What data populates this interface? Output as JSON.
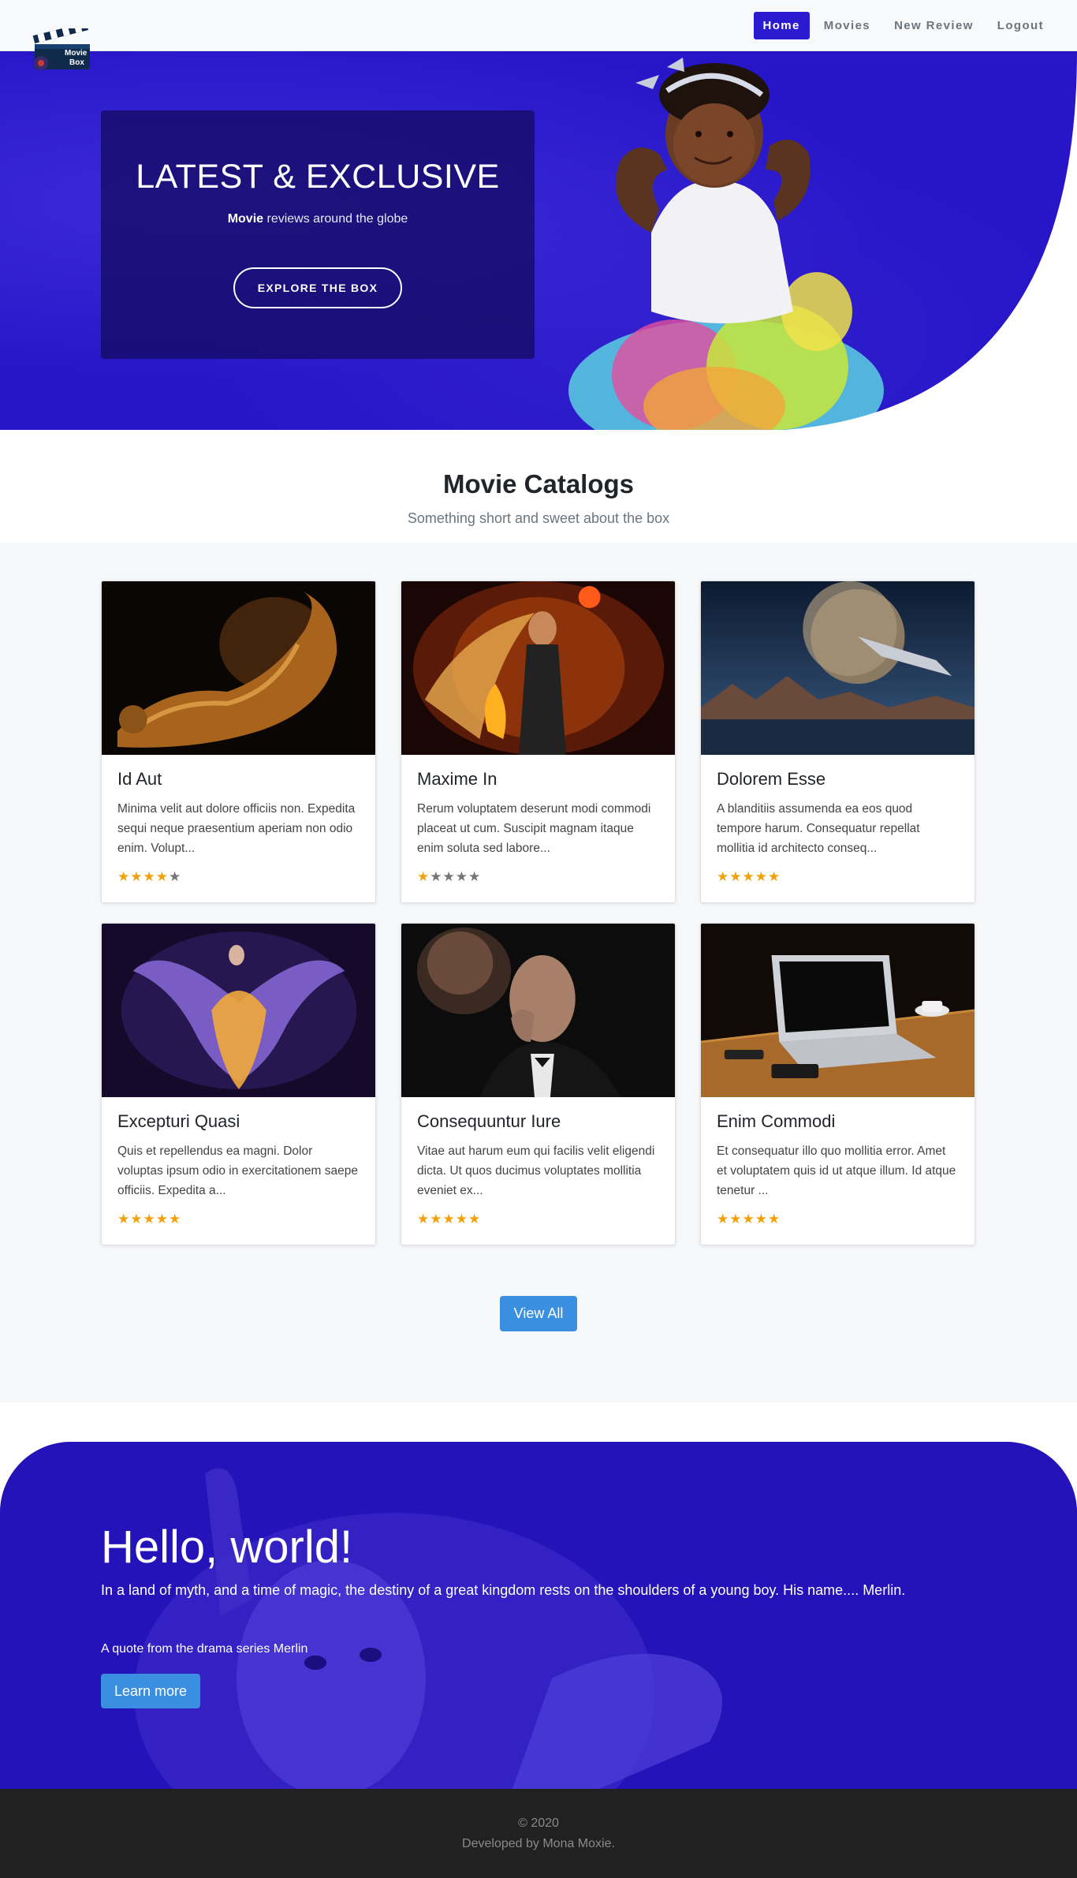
{
  "brand": {
    "logo_text_line1": "Movie",
    "logo_text_line2": "Box"
  },
  "nav": {
    "items": [
      {
        "label": "Home",
        "active": true
      },
      {
        "label": "Movies",
        "active": false
      },
      {
        "label": "New Review",
        "active": false
      },
      {
        "label": "Logout",
        "active": false
      }
    ]
  },
  "hero": {
    "title": "LATEST & EXCLUSIVE",
    "subtitle_bold": "Movie",
    "subtitle_rest": " reviews around the globe",
    "button_label": "EXPLORE THE BOX"
  },
  "catalog": {
    "title": "Movie Catalogs",
    "subtitle": "Something short and sweet about the box",
    "cards": [
      {
        "title": "Id Aut",
        "text": "Minima velit aut dolore officiis non. Expedita sequi neque praesentium aperiam non odio enim. Volupt...",
        "rating": 4,
        "image": "golden-glitter-figure"
      },
      {
        "title": "Maxime In",
        "text": "Rerum voluptatem deserunt modi commodi placeat ut cum. Suscipit magnam itaque enim soluta sed labore...",
        "rating": 1,
        "image": "fire-sorceress"
      },
      {
        "title": "Dolorem Esse",
        "text": "A blanditiis assumenda ea eos quod tempore harum. Consequatur repellat mollitia id architecto conseq...",
        "rating": 5,
        "image": "space-planet-ship"
      },
      {
        "title": "Excepturi Quasi",
        "text": "Quis et repellendus ea magni. Dolor voluptas ipsum odio in exercitationem saepe officiis. Expedita a...",
        "rating": 5,
        "image": "flame-wings-figure"
      },
      {
        "title": "Consequuntur Iure",
        "text": "Vitae aut harum eum qui facilis velit eligendi dicta. Ut quos ducimus voluptates mollitia eveniet ex...",
        "rating": 5,
        "image": "two-men-tuxedo"
      },
      {
        "title": "Enim Commodi",
        "text": "Et consequatur illo quo mollitia error. Amet et voluptatem quis id ut atque illum. Id atque tenetur ...",
        "rating": 5,
        "image": "laptop-on-desk"
      }
    ],
    "view_all_label": "View All"
  },
  "jumbotron": {
    "title": "Hello, world!",
    "lead": "In a land of myth, and a time of magic, the destiny of a great kingdom rests on the shoulders of a young boy. His name.... Merlin.",
    "quote": "A quote from the drama series Merlin",
    "button_label": "Learn more"
  },
  "footer": {
    "copyright": "© 2020",
    "developer": "Developed by Mona Moxie."
  },
  "colors": {
    "primary": "#2a1bd0",
    "hero_bg": "#2716cc",
    "accent_button": "#3a8fe0",
    "star_on": "#f2a10c",
    "star_off": "#757575",
    "footer_bg": "#212121"
  }
}
